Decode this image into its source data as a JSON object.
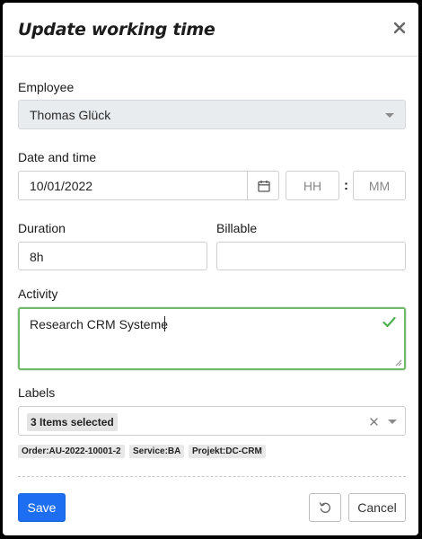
{
  "dialog": {
    "title": "Update working time"
  },
  "employee": {
    "label": "Employee",
    "value": "Thomas Glück"
  },
  "datetime": {
    "label": "Date and time",
    "date_value": "10/01/2022",
    "hour_placeholder": "HH",
    "separator": ":",
    "minute_placeholder": "MM"
  },
  "duration": {
    "label": "Duration",
    "value": "8h"
  },
  "billable": {
    "label": "Billable",
    "value": ""
  },
  "activity": {
    "label": "Activity",
    "value": "Research CRM Systeme"
  },
  "labels": {
    "label": "Labels",
    "selected_summary": "3 Items selected",
    "tags": [
      "Order:AU-2022-10001-2",
      "Service:BA",
      "Projekt:DC-CRM"
    ]
  },
  "footer": {
    "save_label": "Save",
    "cancel_label": "Cancel"
  },
  "colors": {
    "primary": "#1d6ef0",
    "valid": "#4caf50"
  }
}
